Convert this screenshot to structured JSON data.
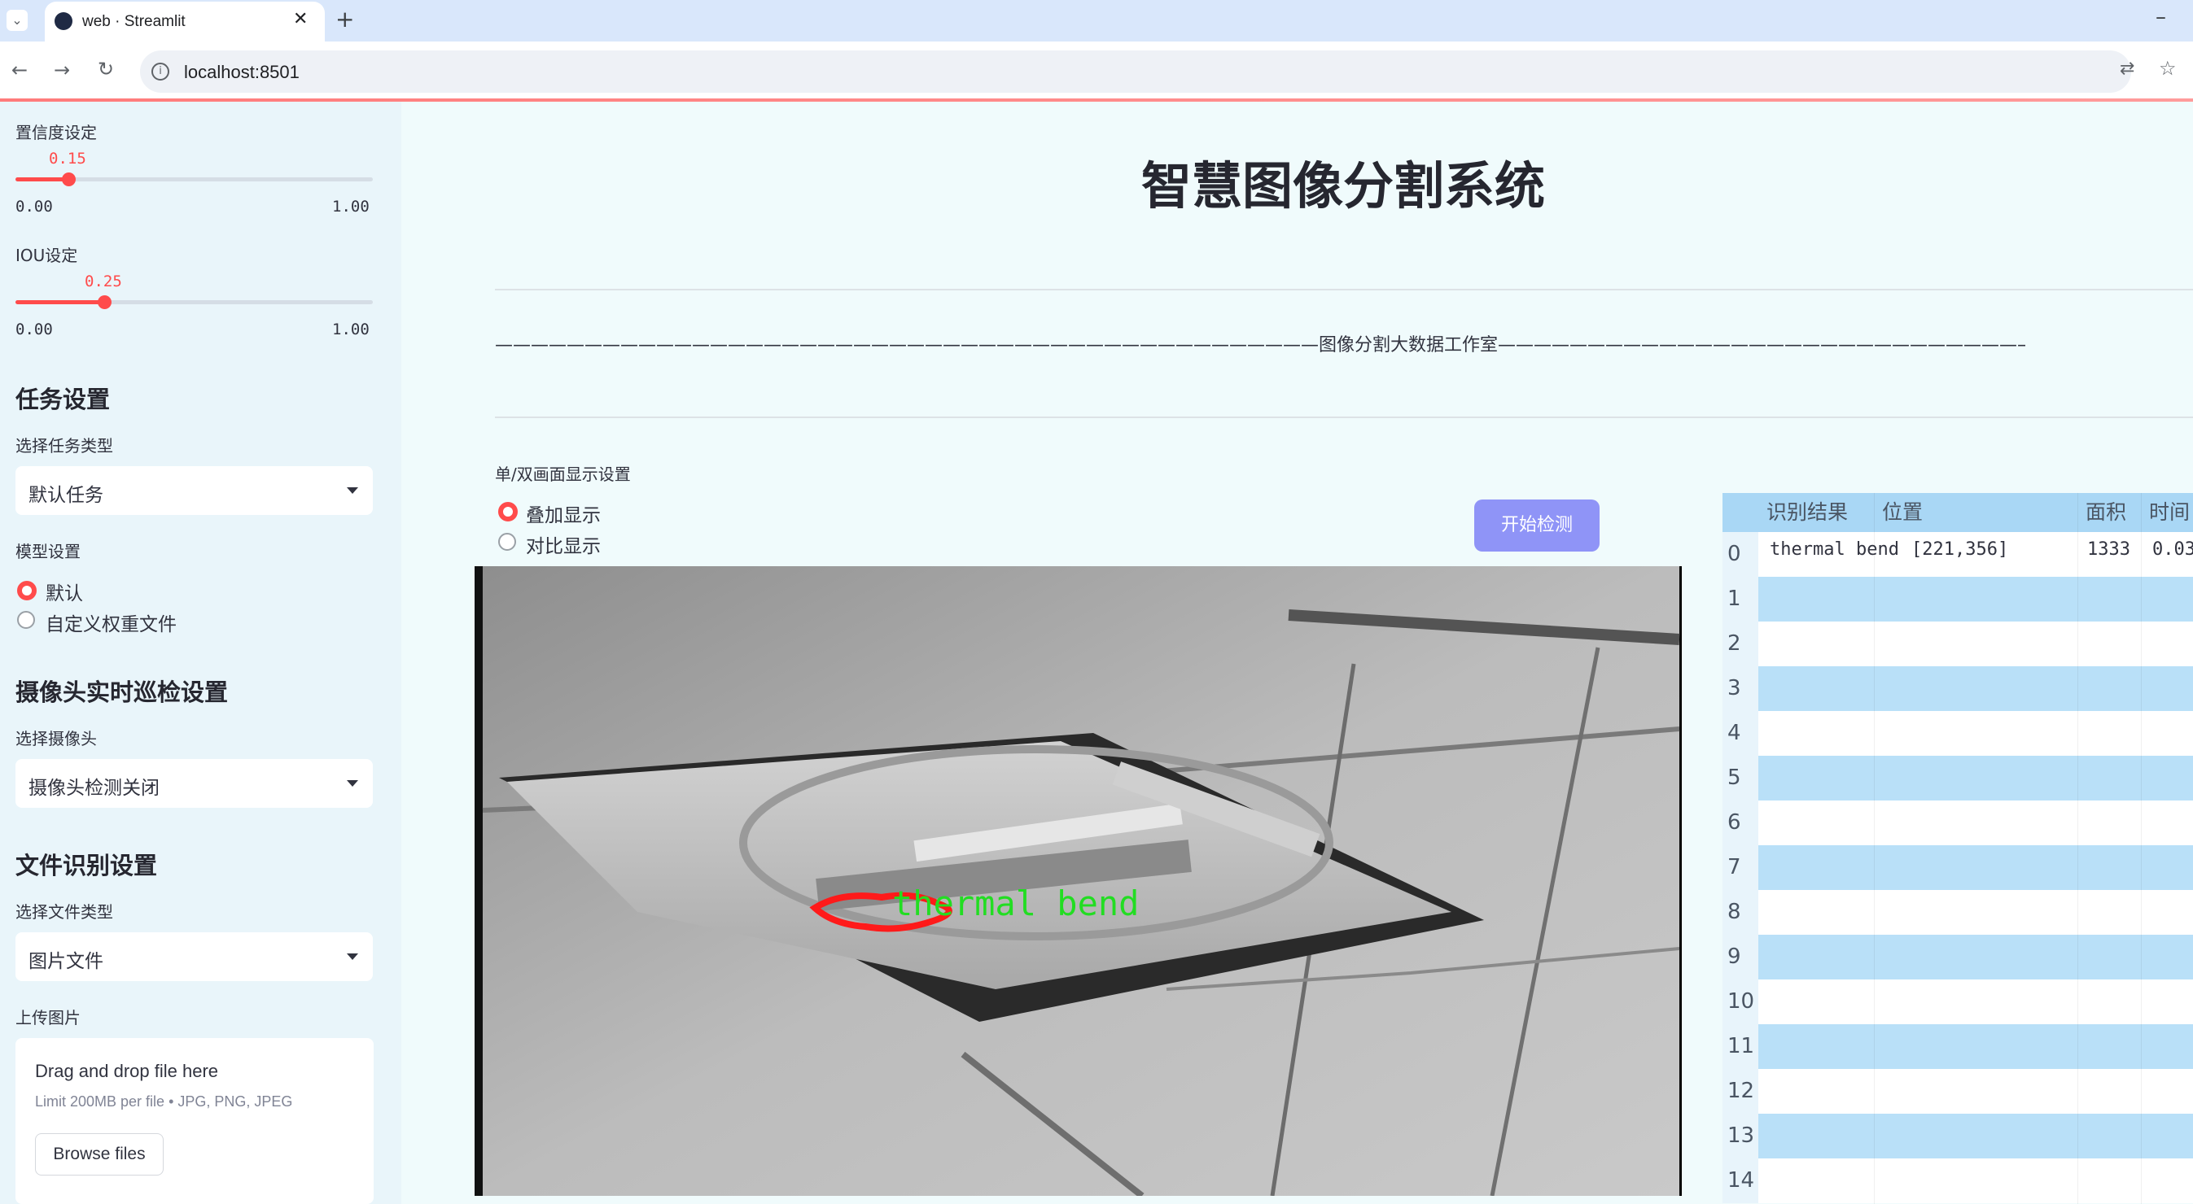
{
  "browser": {
    "tab_title": "web · Streamlit",
    "url": "localhost:8501"
  },
  "sidebar": {
    "confidence": {
      "label": "置信度设定",
      "value": "0.15",
      "min": "0.00",
      "max": "1.00",
      "fraction": 0.15
    },
    "iou": {
      "label": "IOU设定",
      "value": "0.25",
      "min": "0.00",
      "max": "1.00",
      "fraction": 0.25
    },
    "task_header": "任务设置",
    "task_type_label": "选择任务类型",
    "task_type_value": "默认任务",
    "model_label": "模型设置",
    "model_options": [
      "默认",
      "自定义权重文件"
    ],
    "model_selected": 0,
    "camera_header": "摄像头实时巡检设置",
    "camera_label": "选择摄像头",
    "camera_value": "摄像头检测关闭",
    "file_header": "文件识别设置",
    "file_type_label": "选择文件类型",
    "file_type_value": "图片文件",
    "upload_label": "上传图片",
    "upload_drop": "Drag and drop file here",
    "upload_limit": "Limit 200MB per file • JPG, PNG, JPEG",
    "browse_label": "Browse files"
  },
  "main": {
    "title": "智慧图像分割系统",
    "banner": "——————————————————————————————————————————————图像分割大数据工作室——————————————————————————————————————————————",
    "display_label": "单/双画面显示设置",
    "display_options": [
      "叠加显示",
      "对比显示"
    ],
    "display_selected": 0,
    "start_button": "开始检测",
    "detection_label": "thermal bend"
  },
  "table": {
    "headers": [
      "识别结果",
      "位置",
      "面积",
      "时间"
    ],
    "rows": [
      {
        "index": "0",
        "result": "thermal bend",
        "position": "[221,356]",
        "area": "1333",
        "time": "0.03"
      },
      {
        "index": "1"
      },
      {
        "index": "2"
      },
      {
        "index": "3"
      },
      {
        "index": "4"
      },
      {
        "index": "5"
      },
      {
        "index": "6"
      },
      {
        "index": "7"
      },
      {
        "index": "8"
      },
      {
        "index": "9"
      },
      {
        "index": "10"
      },
      {
        "index": "11"
      },
      {
        "index": "12"
      },
      {
        "index": "13"
      },
      {
        "index": "14"
      }
    ]
  },
  "colors": {
    "accent": "#ff4b4b",
    "primary_button": "#8f94f7",
    "table_header": "#a9d7f5",
    "table_stripe": "#b9e0f8",
    "detection_outline": "#ff1a1a",
    "detection_text": "#22dd22"
  }
}
